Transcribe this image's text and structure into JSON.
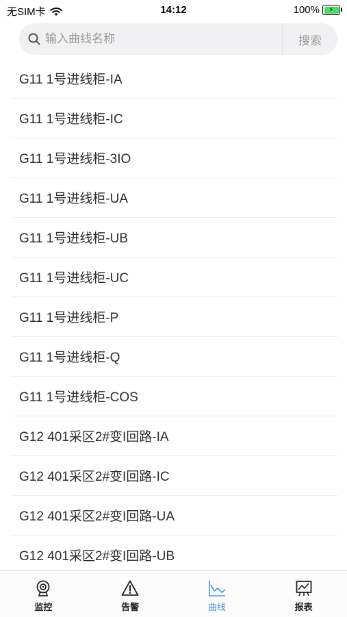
{
  "status_bar": {
    "carrier": "无SIM卡",
    "time": "14:12",
    "battery": "100%"
  },
  "search": {
    "placeholder": "输入曲线名称",
    "value": "",
    "button_label": "搜索"
  },
  "curves": [
    "G11 1号进线柜-IA",
    "G11 1号进线柜-IC",
    "G11 1号进线柜-3IO",
    "G11 1号进线柜-UA",
    "G11 1号进线柜-UB",
    "G11 1号进线柜-UC",
    "G11 1号进线柜-P",
    "G11 1号进线柜-Q",
    "G11 1号进线柜-COS",
    "G12 401采区2#变I回路-IA",
    "G12 401采区2#变I回路-IC",
    "G12 401采区2#变I回路-UA",
    "G12 401采区2#变I回路-UB"
  ],
  "tabs": [
    {
      "label": "监控",
      "icon": "webcam-icon",
      "active": false
    },
    {
      "label": "告警",
      "icon": "warning-icon",
      "active": false
    },
    {
      "label": "曲线",
      "icon": "line-chart-icon",
      "active": true
    },
    {
      "label": "报表",
      "icon": "report-chart-icon",
      "active": false
    }
  ],
  "colors": {
    "active_tab": "#4a90d9",
    "battery": "#4cd964",
    "search_bg": "#f1f1f3"
  }
}
